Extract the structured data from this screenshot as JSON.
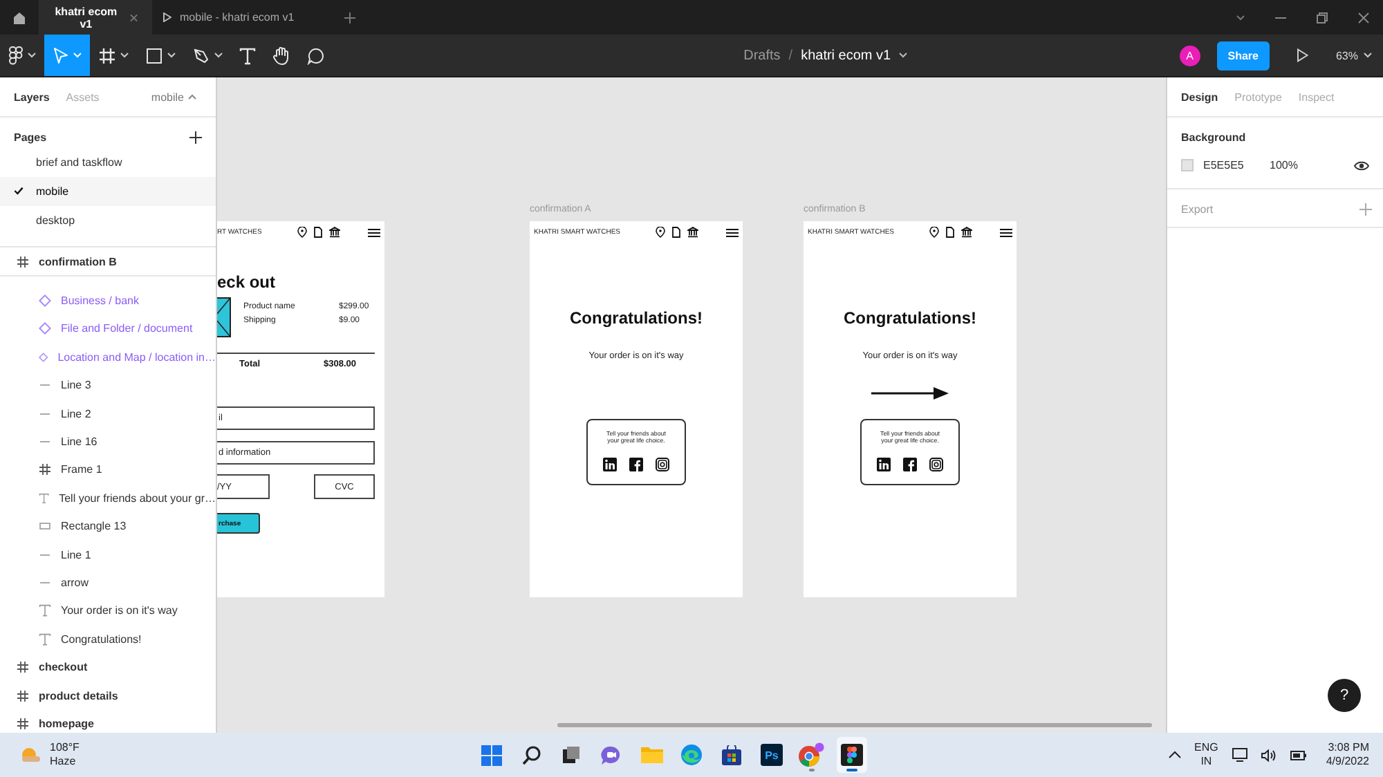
{
  "tabs": [
    {
      "label": "khatri ecom v1",
      "kind": "file",
      "selected": true
    },
    {
      "label": "mobile - khatri ecom v1",
      "kind": "prototype",
      "selected": false
    }
  ],
  "toolbar": {
    "tools": [
      {
        "kind": "main-menu",
        "selected": false,
        "dropdown": true
      },
      {
        "kind": "move",
        "selected": true,
        "dropdown": true
      },
      {
        "kind": "frame",
        "selected": false,
        "dropdown": true
      },
      {
        "kind": "shape",
        "selected": false,
        "dropdown": true
      },
      {
        "kind": "pen",
        "selected": false,
        "dropdown": true
      },
      {
        "kind": "text",
        "selected": false,
        "dropdown": false
      },
      {
        "kind": "hand",
        "selected": false,
        "dropdown": false
      },
      {
        "kind": "comment",
        "selected": false,
        "dropdown": false
      }
    ],
    "breadcrumb": {
      "folder": "Drafts",
      "separator": "/",
      "file": "khatri ecom v1"
    },
    "avatar": "A",
    "share": "Share",
    "zoom": "63%"
  },
  "left_panel": {
    "tabs": [
      {
        "label": "Layers",
        "selected": true
      },
      {
        "label": "Assets",
        "selected": false
      }
    ],
    "page_picker": "mobile",
    "pages_title": "Pages",
    "pages": [
      {
        "label": "brief and taskflow",
        "selected": false
      },
      {
        "label": "mobile",
        "selected": true
      },
      {
        "label": "desktop",
        "selected": false
      }
    ],
    "layers": [
      {
        "name": "confirmation B",
        "kind": "frame",
        "children": [
          {
            "name": "Business / bank",
            "kind": "component"
          },
          {
            "name": "File and Folder / document",
            "kind": "component"
          },
          {
            "name": "Location and Map / location in…",
            "kind": "component"
          },
          {
            "name": "Line 3",
            "kind": "line"
          },
          {
            "name": "Line 2",
            "kind": "line"
          },
          {
            "name": "Line 16",
            "kind": "line"
          },
          {
            "name": "Frame 1",
            "kind": "frame"
          },
          {
            "name": "Tell your friends about your gr…",
            "kind": "text"
          },
          {
            "name": "Rectangle 13",
            "kind": "rect"
          },
          {
            "name": "Line 1",
            "kind": "line"
          },
          {
            "name": "arrow",
            "kind": "line"
          },
          {
            "name": "Your order is on it's way",
            "kind": "text"
          },
          {
            "name": "Congratulations!",
            "kind": "text"
          }
        ]
      },
      {
        "name": "checkout",
        "kind": "frame"
      },
      {
        "name": "product details",
        "kind": "frame"
      },
      {
        "name": "homepage",
        "kind": "frame"
      }
    ]
  },
  "canvas": {
    "checkout_frame": {
      "brand": "RT WATCHES",
      "title": "eck out",
      "items": [
        {
          "name": "Product name",
          "price": "$299.00"
        },
        {
          "name": "Shipping",
          "price": "$9.00"
        }
      ],
      "total": {
        "label": "Total",
        "amount": "$308.00"
      },
      "fields": [
        "il",
        "d information"
      ],
      "expiry": "/YY",
      "cvc": "CVC",
      "button": "rchase"
    },
    "confirmation_frames": [
      {
        "label": "confirmation A",
        "brand": "KHATRI SMART WATCHES",
        "heading": "Congratulations!",
        "message": "Your order is on it's way",
        "arrow": false,
        "share_text": "Tell your friends about your great life choice."
      },
      {
        "label": "confirmation B",
        "brand": "KHATRI SMART WATCHES",
        "heading": "Congratulations!",
        "message": "Your order is on it's way",
        "arrow": true,
        "share_text": "Tell your friends about your great life choice."
      }
    ],
    "help": "?"
  },
  "right_panel": {
    "tabs": [
      {
        "label": "Design",
        "selected": true
      },
      {
        "label": "Prototype",
        "selected": false
      },
      {
        "label": "Inspect",
        "selected": false
      }
    ],
    "background": {
      "title": "Background",
      "hex": "E5E5E5",
      "opacity": "100%",
      "visible": true
    },
    "export": {
      "title": "Export"
    }
  },
  "taskbar": {
    "weather": {
      "temp": "108°F",
      "condition": "Haze"
    },
    "apps": [
      {
        "kind": "start",
        "selected": false,
        "running": false
      },
      {
        "kind": "search",
        "selected": false,
        "running": false
      },
      {
        "kind": "task-view",
        "selected": false,
        "running": false
      },
      {
        "kind": "chat",
        "selected": false,
        "running": false
      },
      {
        "kind": "explorer",
        "selected": false,
        "running": false
      },
      {
        "kind": "edge",
        "selected": false,
        "running": false
      },
      {
        "kind": "store",
        "selected": false,
        "running": false
      },
      {
        "kind": "photoshop",
        "label": "Ps",
        "selected": false,
        "running": false
      },
      {
        "kind": "chrome",
        "selected": false,
        "running": true
      },
      {
        "kind": "figma",
        "selected": true,
        "running": true
      }
    ],
    "language": "ENG",
    "region": "IN",
    "time": "3:08 PM",
    "date": "4/9/2022"
  }
}
